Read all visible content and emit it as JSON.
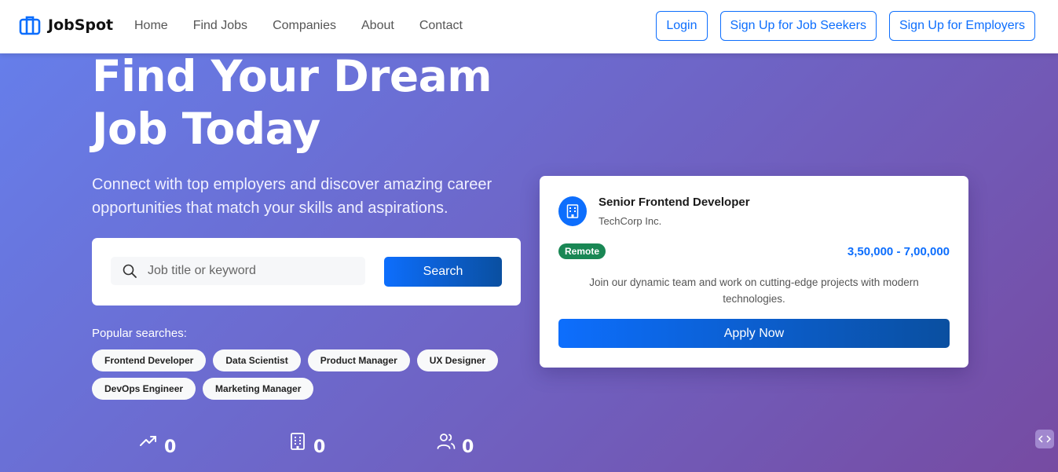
{
  "brand": {
    "name": "JobSpot",
    "icon": "briefcase-icon"
  },
  "nav": {
    "links": [
      "Home",
      "Find Jobs",
      "Companies",
      "About",
      "Contact"
    ],
    "login_label": "Login",
    "signup_seekers_label": "Sign Up for Job Seekers",
    "signup_employers_label": "Sign Up for Employers"
  },
  "hero": {
    "title_line1": "Find Your Dream",
    "title_line2": "Job Today",
    "subtitle": "Connect with top employers and discover amazing career opportunities that match your skills and aspirations."
  },
  "search": {
    "placeholder": "Job title or keyword",
    "value": "",
    "button_label": "Search"
  },
  "popular": {
    "label": "Popular searches:",
    "tags": [
      "Frontend Developer",
      "Data Scientist",
      "Product Manager",
      "UX Designer",
      "DevOps Engineer",
      "Marketing Manager"
    ]
  },
  "stats": [
    {
      "icon": "trending-up-icon",
      "value": "0"
    },
    {
      "icon": "building-icon",
      "value": "0"
    },
    {
      "icon": "users-icon",
      "value": "0"
    }
  ],
  "job_card": {
    "title": "Senior Frontend Developer",
    "company": "TechCorp Inc.",
    "badge": "Remote",
    "salary": "3,50,000 - 7,00,000",
    "description": "Join our dynamic team and work on cutting-edge projects with modern technologies.",
    "apply_label": "Apply Now"
  },
  "colors": {
    "primary": "#0d6efd",
    "success": "#198754",
    "hero_gradient_start": "#667eea",
    "hero_gradient_end": "#764ba2"
  }
}
